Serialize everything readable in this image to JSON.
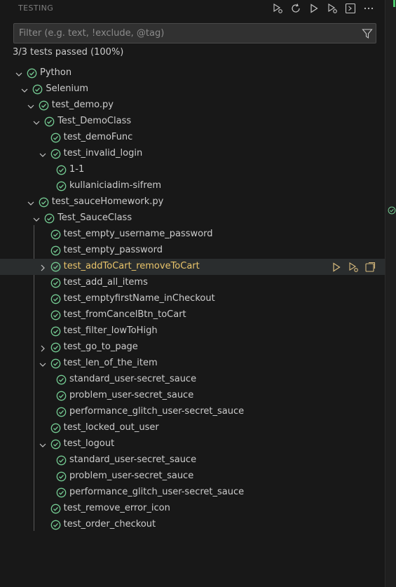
{
  "header": {
    "title": "TESTING"
  },
  "filter": {
    "placeholder": "Filter (e.g. text, !exclude, @tag)"
  },
  "summary": "3/3 tests passed (100%)",
  "colors": {
    "pass": "#73c991",
    "selected_label": "#e9c46a",
    "accent": "#d7ba7d"
  },
  "tree": [
    {
      "label": "Python",
      "depth": 0,
      "chevron": "down"
    },
    {
      "label": "Selenium",
      "depth": 1,
      "chevron": "down"
    },
    {
      "label": "test_demo.py",
      "depth": 2,
      "chevron": "down"
    },
    {
      "label": "Test_DemoClass",
      "depth": 3,
      "chevron": "down"
    },
    {
      "label": "test_demoFunc",
      "depth": 4,
      "chevron": "none"
    },
    {
      "label": "test_invalid_login",
      "depth": 4,
      "chevron": "down"
    },
    {
      "label": "1-1",
      "depth": 5,
      "chevron": "none"
    },
    {
      "label": "kullaniciadim-sifrem",
      "depth": 5,
      "chevron": "none"
    },
    {
      "label": "test_sauceHomework.py",
      "depth": 2,
      "chevron": "down"
    },
    {
      "label": "Test_SauceClass",
      "depth": 3,
      "chevron": "down"
    },
    {
      "label": "test_empty_username_password",
      "depth": 4,
      "chevron": "none"
    },
    {
      "label": "test_empty_password",
      "depth": 4,
      "chevron": "none"
    },
    {
      "label": "test_addToCart_removeToCart",
      "depth": 4,
      "chevron": "right",
      "selected": true
    },
    {
      "label": "test_add_all_items",
      "depth": 4,
      "chevron": "none"
    },
    {
      "label": "test_emptyfirstName_inCheckout",
      "depth": 4,
      "chevron": "none"
    },
    {
      "label": "test_fromCancelBtn_toCart",
      "depth": 4,
      "chevron": "none"
    },
    {
      "label": "test_filter_lowToHigh",
      "depth": 4,
      "chevron": "none"
    },
    {
      "label": "test_go_to_page",
      "depth": 4,
      "chevron": "right"
    },
    {
      "label": "test_len_of_the_item",
      "depth": 4,
      "chevron": "down"
    },
    {
      "label": "standard_user-secret_sauce",
      "depth": 5,
      "chevron": "none"
    },
    {
      "label": "problem_user-secret_sauce",
      "depth": 5,
      "chevron": "none"
    },
    {
      "label": "performance_glitch_user-secret_sauce",
      "depth": 5,
      "chevron": "none"
    },
    {
      "label": "test_locked_out_user",
      "depth": 4,
      "chevron": "none"
    },
    {
      "label": "test_logout",
      "depth": 4,
      "chevron": "down"
    },
    {
      "label": "standard_user-secret_sauce",
      "depth": 5,
      "chevron": "none"
    },
    {
      "label": "problem_user-secret_sauce",
      "depth": 5,
      "chevron": "none"
    },
    {
      "label": "performance_glitch_user-secret_sauce",
      "depth": 5,
      "chevron": "none"
    },
    {
      "label": "test_remove_error_icon",
      "depth": 4,
      "chevron": "none"
    },
    {
      "label": "test_order_checkout",
      "depth": 4,
      "chevron": "none"
    }
  ]
}
